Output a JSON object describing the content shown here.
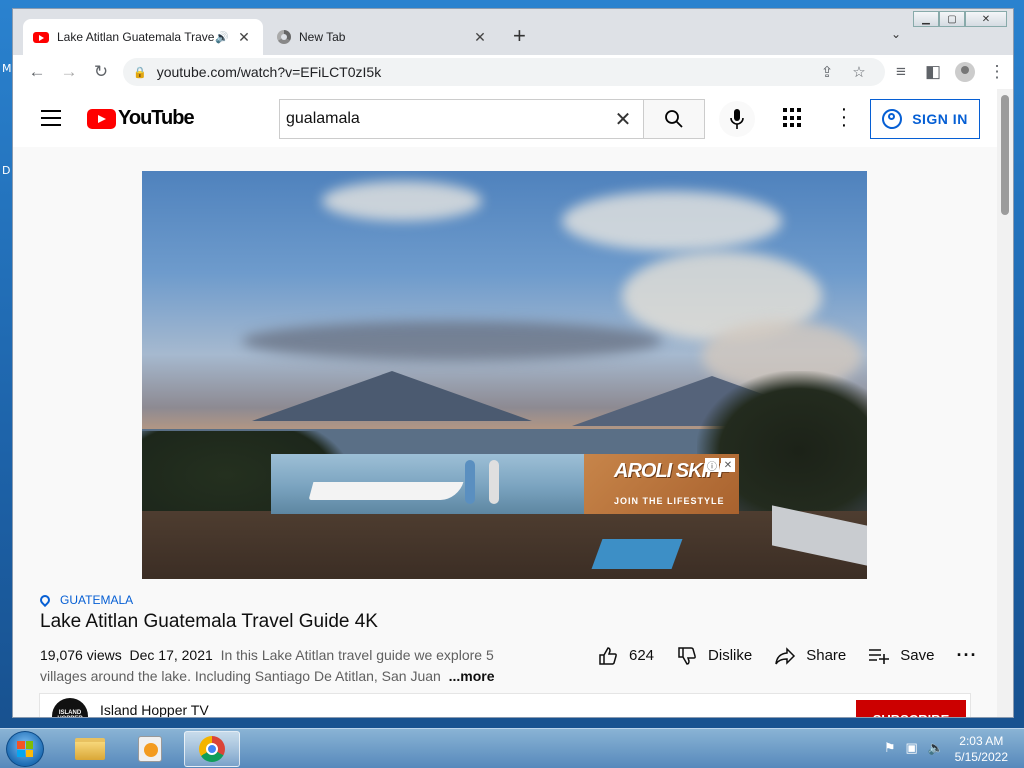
{
  "desktop": {
    "letter_m": "M",
    "letter_d": "D"
  },
  "browser": {
    "tabs": [
      {
        "title": "Lake Atitlan Guatemala Trave",
        "active": true
      },
      {
        "title": "New Tab",
        "active": false
      }
    ],
    "url": "youtube.com/watch?v=EFiLCT0zI5k"
  },
  "youtube": {
    "logo_text": "YouTube",
    "search_value": "gualamala",
    "signin_label": "SIGN IN",
    "video": {
      "location_tag": "GUATEMALA",
      "title": "Lake Atitlan Guatemala Travel Guide 4K",
      "views": "19,076 views",
      "date": "Dec 17, 2021",
      "description": "In this Lake Atitlan travel guide we explore 5 villages around the lake. Including Santiago De Atitlan, San Juan",
      "more_label": "...more",
      "likes": "624",
      "dislike_label": "Dislike",
      "share_label": "Share",
      "save_label": "Save"
    },
    "ad": {
      "brand": "CAROLINA SKIFF",
      "brand_display": "AROLI SKIFF",
      "tagline": "JOIN THE LIFESTYLE"
    },
    "channel": {
      "name": "Island Hopper TV",
      "avatar_text": "ISLAND HOPPER",
      "subscribe_label": "SUBSCRIBE"
    }
  },
  "taskbar": {
    "time": "2:03 AM",
    "date": "5/15/2022"
  }
}
